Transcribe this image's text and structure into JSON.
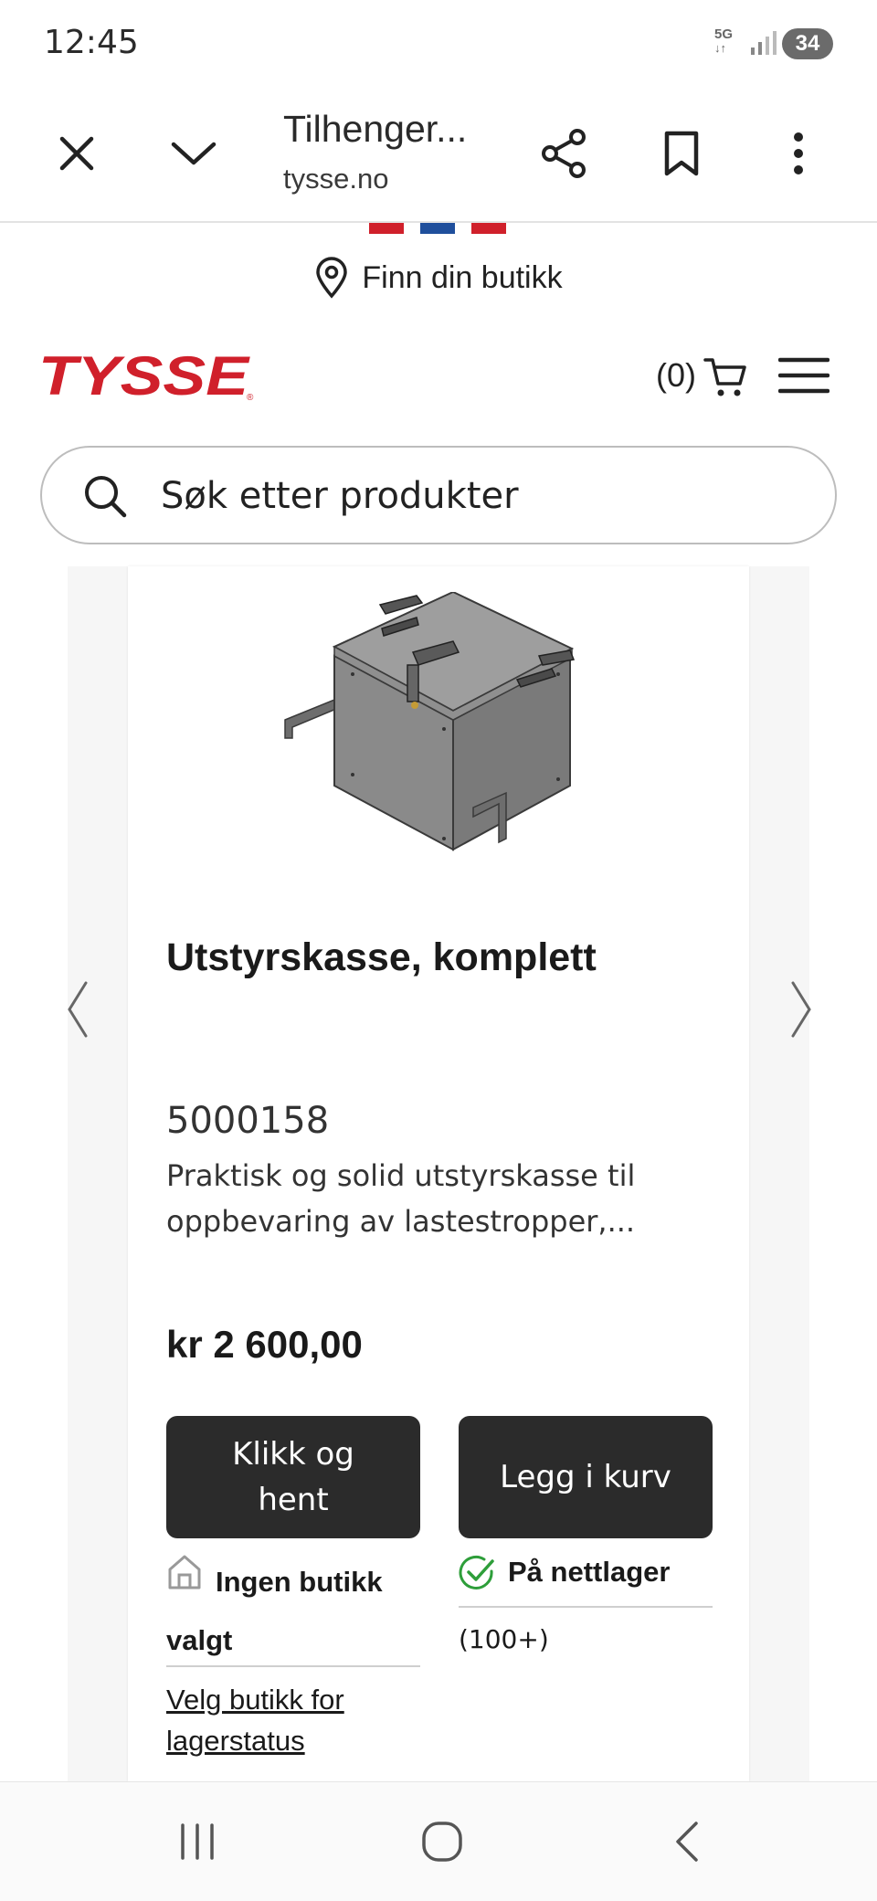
{
  "status_bar": {
    "time": "12:45",
    "network": "5G",
    "battery": "34"
  },
  "browser": {
    "title": "Tilhenger...",
    "domain": "tysse.no",
    "icons": {
      "close": "close-icon",
      "dropdown": "chevron-down-icon",
      "share": "share-icon",
      "bookmark": "bookmark-icon",
      "more": "more-vertical-icon"
    }
  },
  "site": {
    "flag_colors": [
      "#d0202b",
      "#1f4f9c",
      "#d0202b"
    ],
    "find_store": "Finn din butikk",
    "logo_text": "TYSSE",
    "brand_color": "#d0202b",
    "cart_count": "(0)",
    "search_placeholder": "Søk etter produkter"
  },
  "product": {
    "title": "Utstyrskasse, komplett",
    "sku": "5000158",
    "description": "Praktisk og solid utstyrskasse til oppbevaring av lastestropper,...",
    "price": "kr 2 600,00",
    "click_collect_label": "Klikk og hent",
    "add_to_cart_label": "Legg i kurv",
    "store_status": "Ingen butikk valgt",
    "choose_store_link": "Velg butikk for lagerstatus",
    "web_status": "På nettlager",
    "stock_count": "(100+)"
  },
  "colors": {
    "button_bg": "#2b2b2b",
    "check_green": "#2e9e3a"
  }
}
